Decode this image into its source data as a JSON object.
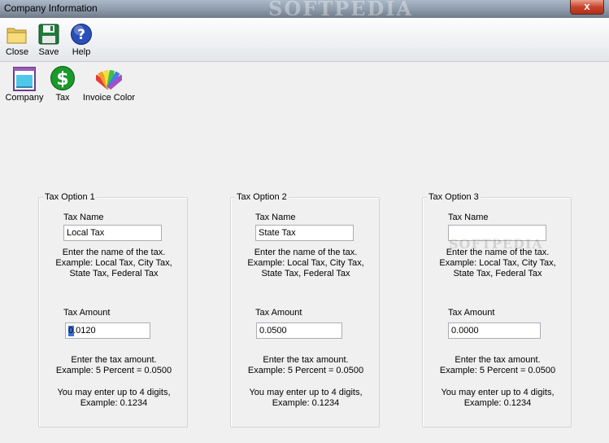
{
  "window": {
    "title": "Company Information",
    "close_glyph": "x",
    "background_text": "SOFTPEDIA"
  },
  "toolbar": [
    {
      "label": "Close",
      "icon": "folder-icon"
    },
    {
      "label": "Save",
      "icon": "floppy-disk-icon"
    },
    {
      "label": "Help",
      "icon": "help-icon"
    }
  ],
  "sections": [
    {
      "label": "Company",
      "icon": "clipboard-icon"
    },
    {
      "label": "Tax",
      "icon": "dollar-icon"
    },
    {
      "label": "Invoice Color",
      "icon": "color-swatches-icon"
    }
  ],
  "tax_options": [
    {
      "title": "Tax Option 1",
      "name_label": "Tax Name",
      "name_value": "Local Tax",
      "name_help": [
        "Enter the name of the tax.",
        "Example: Local Tax, City Tax,",
        "State Tax, Federal Tax"
      ],
      "amount_label": "Tax Amount",
      "amount_value": "0.0120",
      "amount_help": [
        "Enter the tax amount.",
        "Example: 5 Percent = 0.0500"
      ],
      "digits_help": [
        "You may enter up to 4 digits,",
        "Example: 0.1234"
      ]
    },
    {
      "title": "Tax Option 2",
      "name_label": "Tax Name",
      "name_value": "State Tax",
      "name_help": [
        "Enter the name of the tax.",
        "Example: Local Tax, City Tax,",
        "State Tax, Federal Tax"
      ],
      "amount_label": "Tax Amount",
      "amount_value": "0.0500",
      "amount_help": [
        "Enter the tax amount.",
        "Example: 5 Percent = 0.0500"
      ],
      "digits_help": [
        "You may enter up to 4 digits,",
        "Example: 0.1234"
      ]
    },
    {
      "title": "Tax Option 3",
      "name_label": "Tax Name",
      "name_value": "",
      "name_help": [
        "Enter the name of the tax.",
        "Example: Local Tax, City Tax,",
        "State Tax, Federal Tax"
      ],
      "amount_label": "Tax Amount",
      "amount_value": "0.0000",
      "amount_help": [
        "Enter the tax amount.",
        "Example: 5 Percent = 0.0500"
      ],
      "digits_help": [
        "You may enter up to 4 digits,",
        "Example: 0.1234"
      ]
    }
  ],
  "overlay_watermark": "SOFTPEDIA",
  "colors": {
    "accent": "#3a6fd8",
    "close_button": "#c7442a",
    "dollar_green": "#1a9a2a"
  }
}
